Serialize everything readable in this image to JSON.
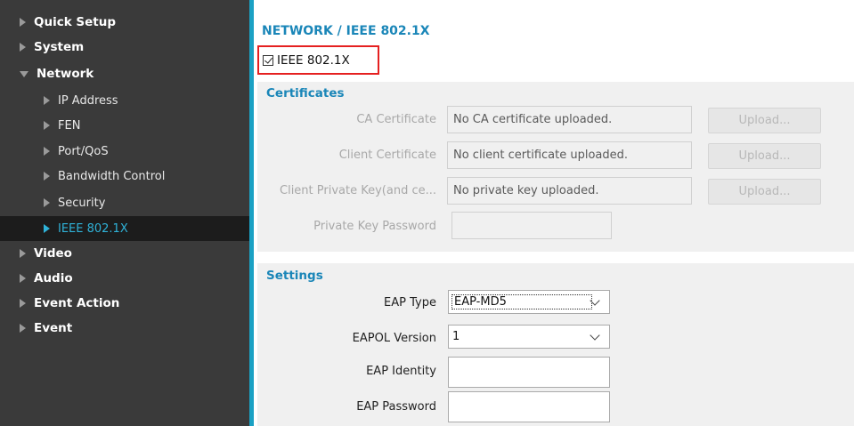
{
  "sidebar": {
    "items": [
      {
        "label": "Quick Setup"
      },
      {
        "label": "System"
      },
      {
        "label": "Network"
      },
      {
        "label": "IP Address"
      },
      {
        "label": "FEN"
      },
      {
        "label": "Port/QoS"
      },
      {
        "label": "Bandwidth Control"
      },
      {
        "label": "Security"
      },
      {
        "label": "IEEE 802.1X"
      },
      {
        "label": "Video"
      },
      {
        "label": "Audio"
      },
      {
        "label": "Event Action"
      },
      {
        "label": "Event"
      }
    ]
  },
  "main": {
    "title": "NETWORK / IEEE 802.1X",
    "ieee_checkbox": {
      "label": "IEEE 802.1X",
      "checked": true
    },
    "certificates": {
      "title": "Certificates",
      "rows": [
        {
          "label": "CA Certificate",
          "value": "No CA certificate uploaded.",
          "button": "Upload..."
        },
        {
          "label": "Client Certificate",
          "value": "No client certificate uploaded.",
          "button": "Upload..."
        },
        {
          "label": "Client Private Key(and ce...",
          "value": "No private key uploaded.",
          "button": "Upload..."
        }
      ],
      "password_label": "Private Key Password",
      "password_value": ""
    },
    "settings": {
      "title": "Settings",
      "eap_type_label": "EAP Type",
      "eap_type_value": "EAP-MD5",
      "eapol_version_label": "EAPOL Version",
      "eapol_version_value": "1",
      "eap_identity_label": "EAP Identity",
      "eap_identity_value": "",
      "eap_password_label": "EAP Password",
      "eap_password_value": ""
    }
  },
  "colors": {
    "sidebar_bg": "#3a3a3a",
    "accent": "#1ba1c4",
    "active_text": "#2fb2d8",
    "title_blue": "#1a86b8",
    "highlight_red": "#e52020"
  }
}
